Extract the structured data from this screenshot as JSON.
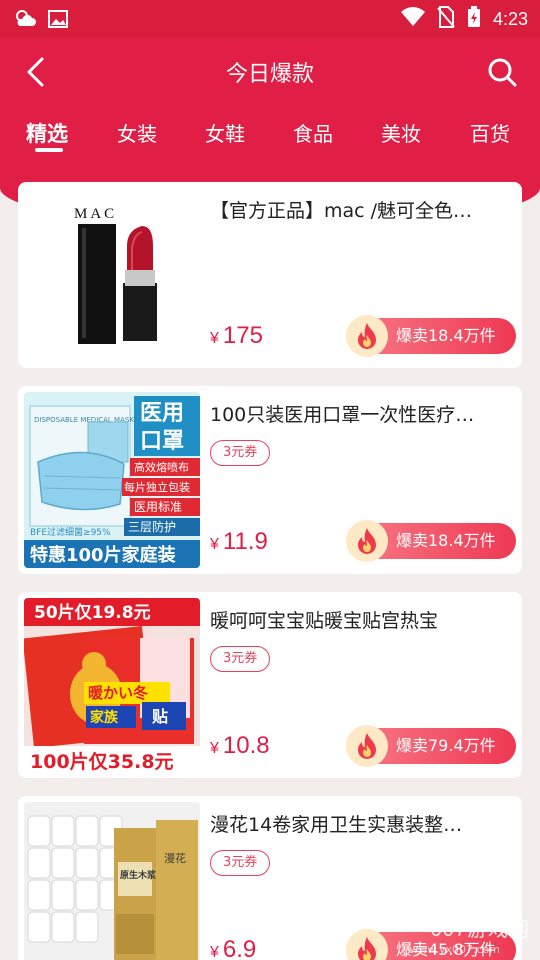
{
  "status_bar": {
    "time": "4:23",
    "icons": [
      "weather-icon",
      "image-icon",
      "wifi-icon",
      "no-sim-icon",
      "battery-charging-icon"
    ]
  },
  "header": {
    "title": "今日爆款",
    "back_icon": "chevron-left-icon",
    "search_icon": "search-icon",
    "background_color": "#e01e46"
  },
  "tabs": [
    {
      "label": "精选",
      "active": true
    },
    {
      "label": "女装",
      "active": false
    },
    {
      "label": "女鞋",
      "active": false
    },
    {
      "label": "食品",
      "active": false
    },
    {
      "label": "美妆",
      "active": false
    },
    {
      "label": "百货",
      "active": false
    }
  ],
  "products": [
    {
      "title": "【官方正品】mac /魅可全色…",
      "coupon": "",
      "currency": "¥",
      "price": "175",
      "sold": "爆卖18.4万件",
      "thumb_text": {
        "brand": "MAC"
      }
    },
    {
      "title": "100只装医用口罩一次性医疗…",
      "coupon": "3元券",
      "currency": "¥",
      "price": "11.9",
      "sold": "爆卖18.4万件",
      "thumb_text": {
        "label1": "医用",
        "label2": "口罩",
        "pack": "DISPOSABLE MEDICAL MASK",
        "feature1": "高效熔喷布",
        "feature2": "每片独立包装",
        "feature3": "医用标准",
        "feature4": "三层防护",
        "bfe": "BFE过滤细菌≥95%",
        "bottom": "特惠100片家庭装"
      }
    },
    {
      "title": "暖呵呵宝宝贴暖宝贴宫热宝",
      "coupon": "3元券",
      "currency": "¥",
      "price": "10.8",
      "sold": "爆卖79.4万件",
      "thumb_text": {
        "top": "50片仅19.8元",
        "center": "暖かい冬",
        "family": "家族",
        "sticker": "贴",
        "bottom": "100片仅35.8元"
      }
    },
    {
      "title": "漫花14卷家用卫生实惠装整…",
      "coupon": "3元券",
      "currency": "¥",
      "price": "6.9",
      "sold": "爆卖45.8万件",
      "thumb_text": {
        "pack1": "原生木浆",
        "pack2": "漫花"
      }
    }
  ],
  "watermark": {
    "main": "007游戏网",
    "sub": "www.yx007.com"
  },
  "colors": {
    "accent": "#e01e46",
    "price": "#e01e46",
    "coupon": "#e8425a",
    "sold_gradient_start": "#f87a86",
    "sold_gradient_end": "#ee3852"
  }
}
